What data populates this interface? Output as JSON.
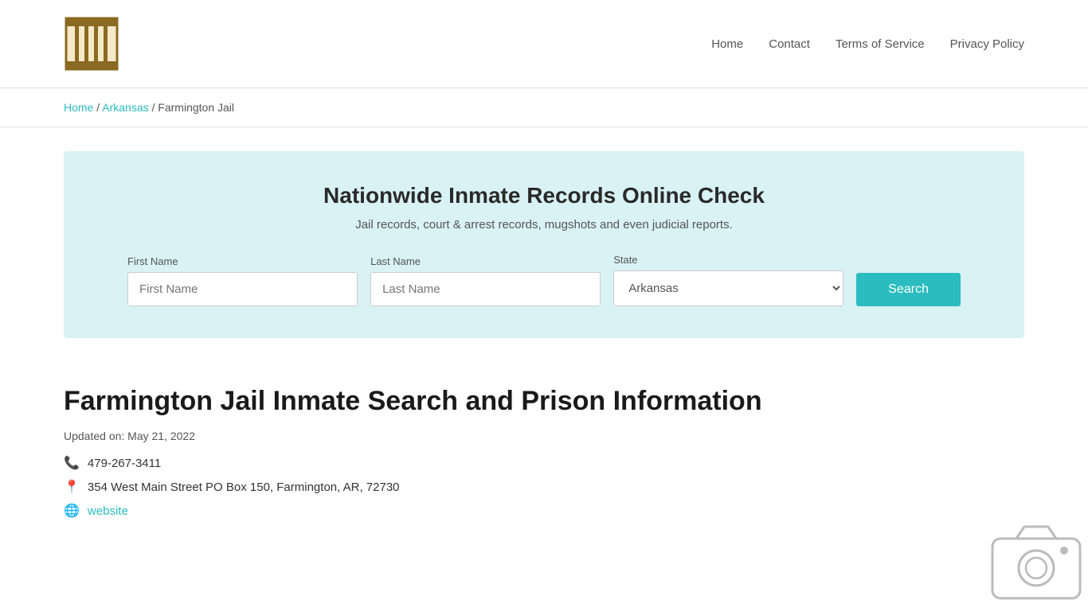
{
  "header": {
    "logo_alt": "Jail Records Logo",
    "nav": {
      "home": "Home",
      "contact": "Contact",
      "terms": "Terms of Service",
      "privacy": "Privacy Policy"
    }
  },
  "breadcrumb": {
    "home": "Home",
    "state": "Arkansas",
    "current": "Farmington Jail"
  },
  "search_banner": {
    "title": "Nationwide Inmate Records Online Check",
    "subtitle": "Jail records, court & arrest records, mugshots and even judicial reports.",
    "first_name_label": "First Name",
    "first_name_placeholder": "First Name",
    "last_name_label": "Last Name",
    "last_name_placeholder": "Last Name",
    "state_label": "State",
    "state_value": "Arkansas",
    "search_button": "Search"
  },
  "page": {
    "title": "Farmington Jail Inmate Search and Prison Information",
    "updated": "Updated on: May 21, 2022",
    "phone": "479-267-3411",
    "address": "354 West Main Street PO Box 150, Farmington, AR, 72730",
    "website_label": "website",
    "website_url": "#"
  }
}
